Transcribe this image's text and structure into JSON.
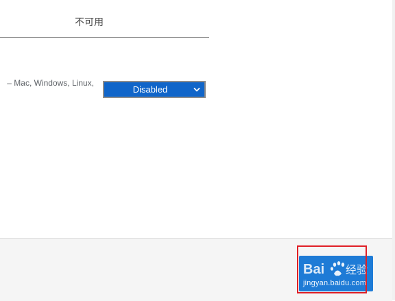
{
  "header": {
    "column_label": "不可用"
  },
  "flag": {
    "description_fragment": "– Mac, Windows, Linux,",
    "select_value": "Disabled"
  },
  "watermark": {
    "brand": "Baidu 经验",
    "url": "jingyan.baidu.com"
  },
  "colors": {
    "select_bg": "#1065c9",
    "button_bg": "#1e7bd6",
    "highlight": "#e01f26",
    "footer_bg": "#f5f5f5"
  }
}
